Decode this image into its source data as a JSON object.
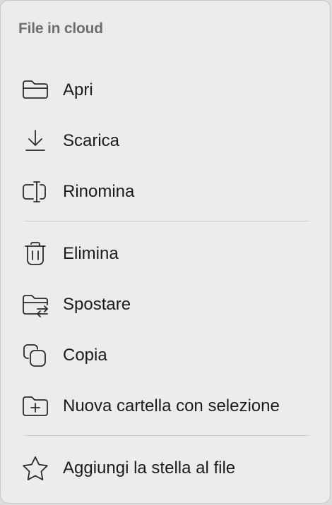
{
  "menu": {
    "header": "File in cloud",
    "items": [
      {
        "label": "Apri",
        "icon": "folder-open-icon"
      },
      {
        "label": "Scarica",
        "icon": "download-icon"
      },
      {
        "label": "Rinomina",
        "icon": "rename-icon"
      },
      {
        "label": "Elimina",
        "icon": "trash-icon"
      },
      {
        "label": "Spostare",
        "icon": "move-folder-icon"
      },
      {
        "label": "Copia",
        "icon": "copy-icon"
      },
      {
        "label": "Nuova cartella con selezione",
        "icon": "new-folder-icon"
      },
      {
        "label": "Aggiungi la stella al file",
        "icon": "star-icon"
      }
    ]
  }
}
